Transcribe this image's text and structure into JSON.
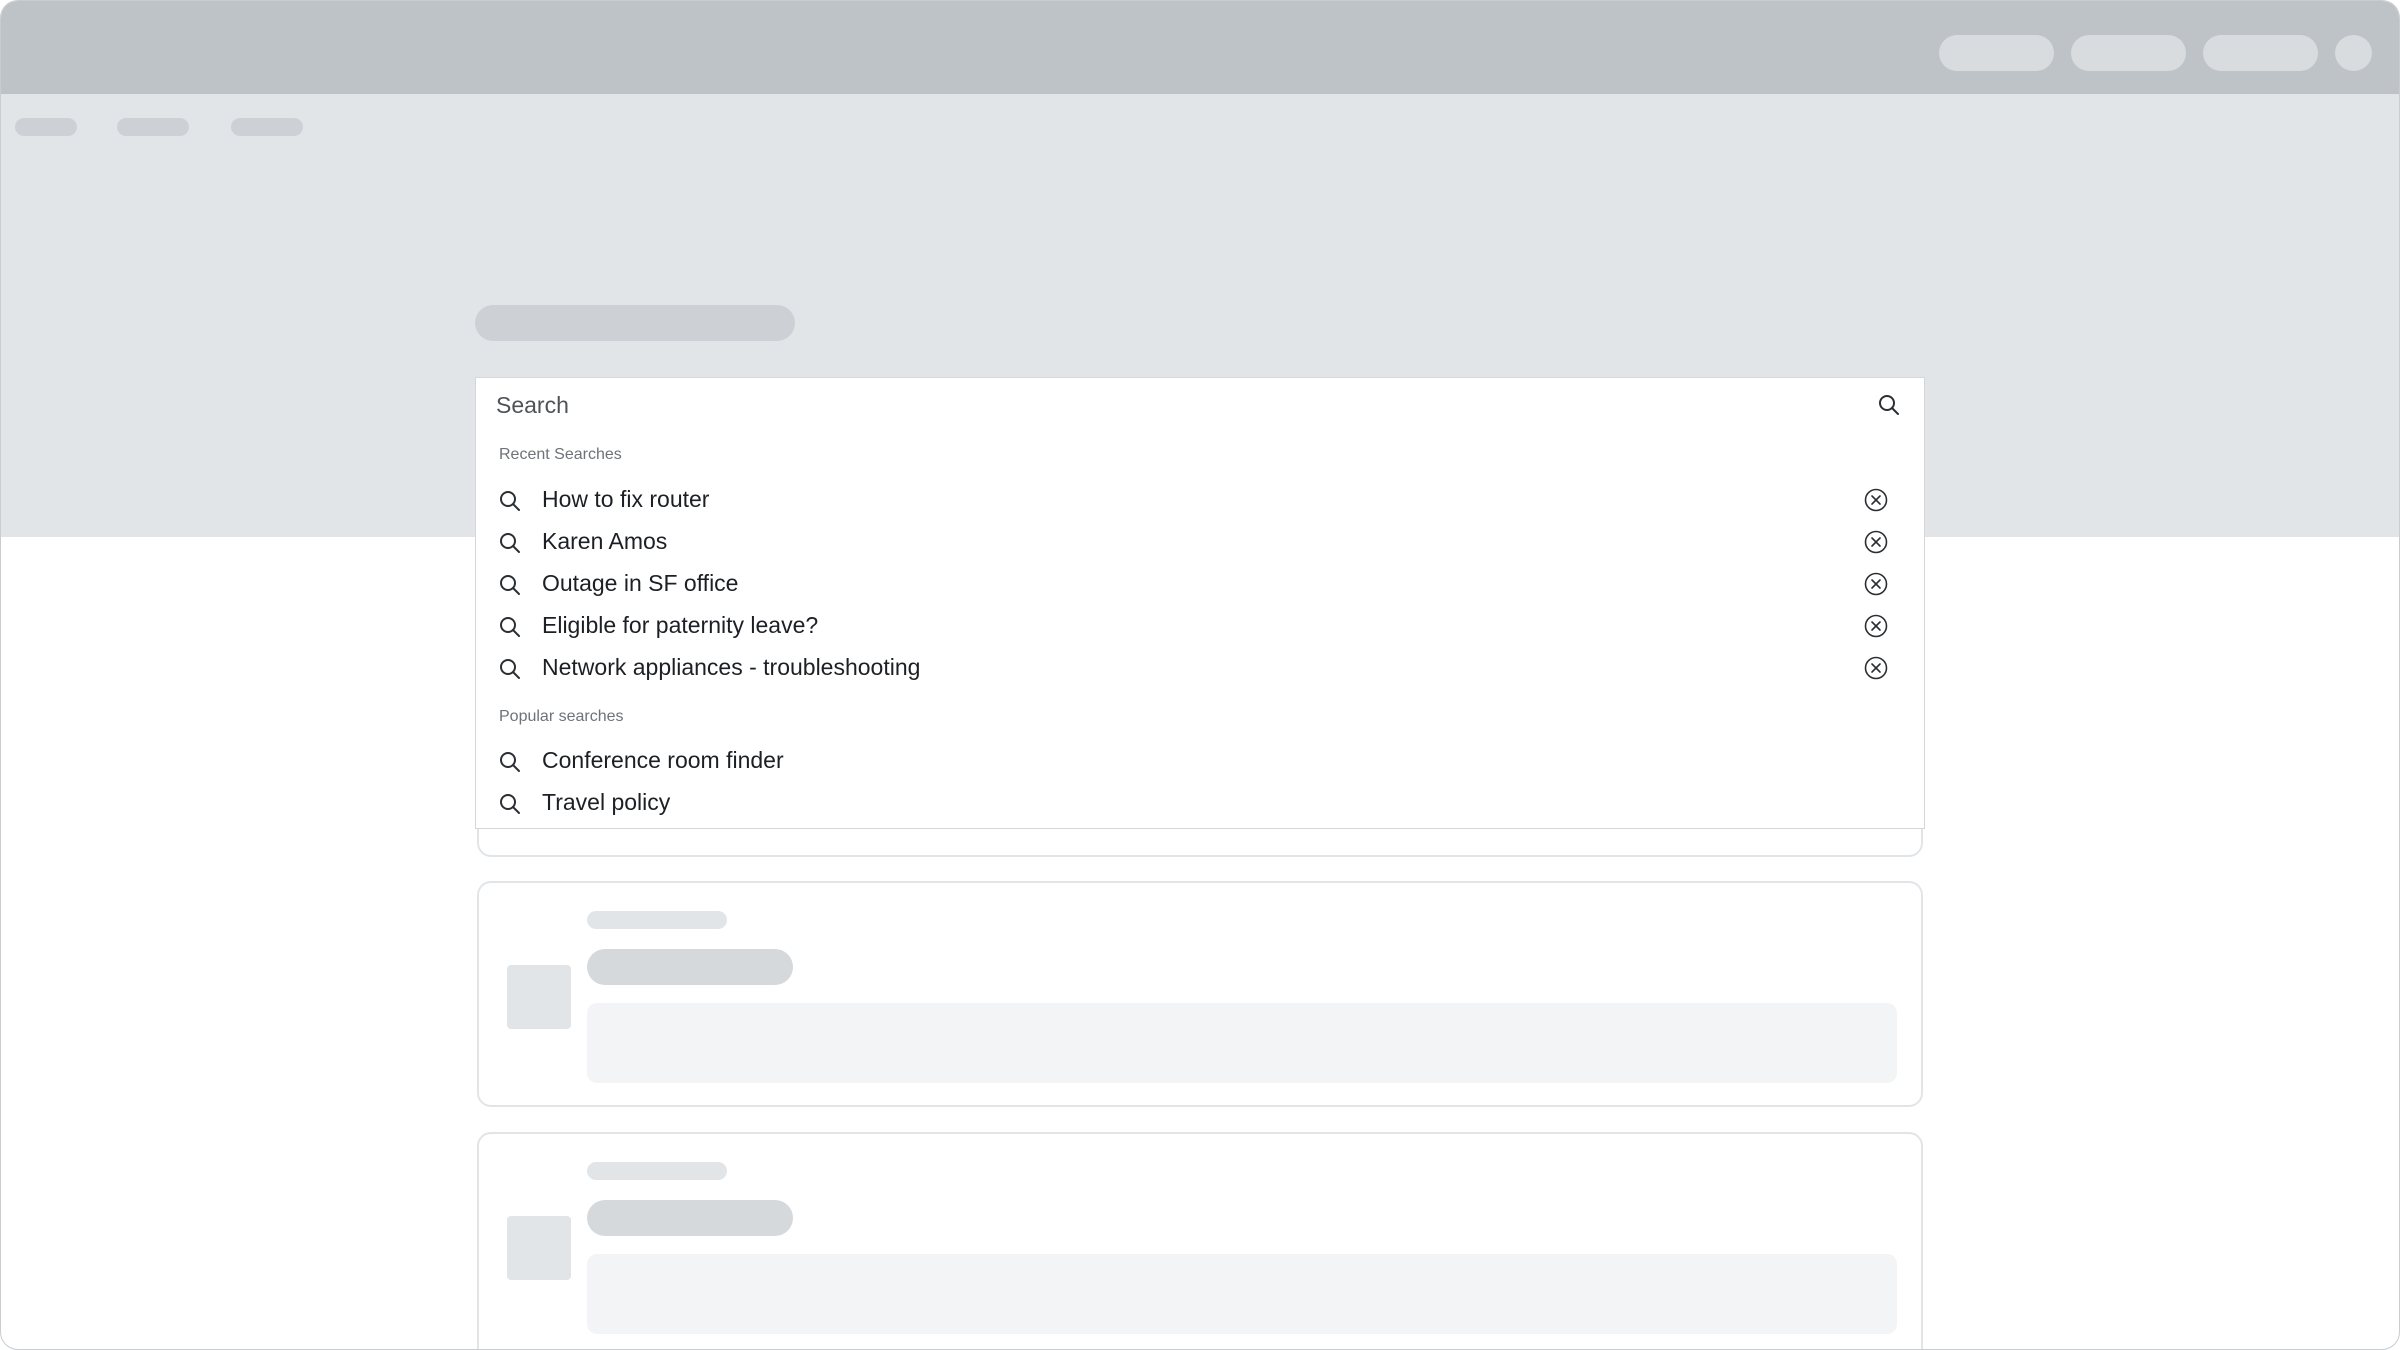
{
  "search": {
    "placeholder": "Search",
    "value": ""
  },
  "recent": {
    "label": "Recent Searches",
    "items": [
      {
        "text": "How to fix router"
      },
      {
        "text": "Karen Amos"
      },
      {
        "text": "Outage in SF office"
      },
      {
        "text": "Eligible for paternity leave?"
      },
      {
        "text": "Network appliances - troubleshooting"
      }
    ]
  },
  "popular": {
    "label": "Popular searches",
    "items": [
      {
        "text": "Conference room finder"
      },
      {
        "text": "Travel policy"
      }
    ]
  },
  "colors": {
    "topbar": "#bdc3c7",
    "hero": "#e2e5e8",
    "text": "#1c2024",
    "muted": "#6d7378"
  }
}
